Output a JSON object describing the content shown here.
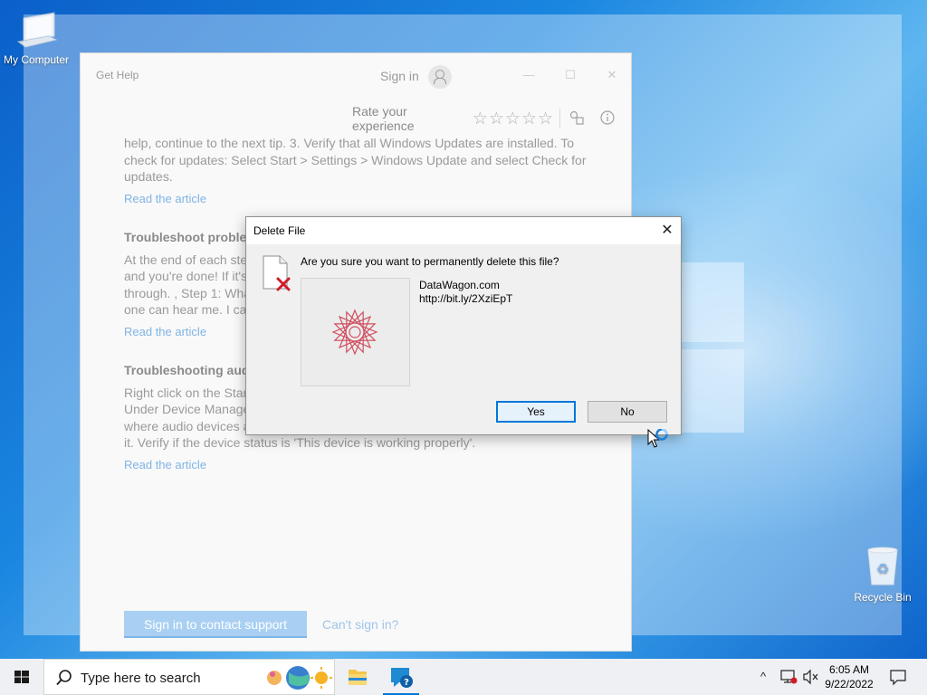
{
  "desktop": {
    "icons": {
      "my_computer": "My Computer",
      "recycle_bin": "Recycle Bin"
    }
  },
  "help_window": {
    "title": "Get Help",
    "sign_in": "Sign in",
    "controls": {
      "minimize": "—",
      "maximize": "☐",
      "close": "✕"
    },
    "rate_label": "Rate your experience",
    "stars": 5,
    "article1_text_1": "help, continue to the next tip. 3. Verify that all Windows Updates are installed. To",
    "article1_text_2": "check for updates: Select Start > Settings > Windows Update and select Check for",
    "article1_text_3": "updates.",
    "article1_link": "Read the article",
    "article2_heading": "Troubleshoot problen",
    "article2_text_1": "At the end of each ste",
    "article2_text_2": "and you're done! If it's",
    "article2_text_3": "through. , Step 1: Wha",
    "article2_text_4": "one can hear me. I can",
    "article2_link": "Read the article",
    "article3_heading": "Troubleshooting audi",
    "article3_text_1": "Right click on the Star",
    "article3_text_2": "Under Device Manage",
    "article3_text_3": "where audio devices are listed. Locate your audio device/driver and double click on",
    "article3_text_4": "it. Verify if the device status is 'This device is working properly'.",
    "article3_link": "Read the article",
    "contact_button": "Sign in to contact support",
    "cant_sign_in": "Can't sign in?"
  },
  "dialog": {
    "title": "Delete File",
    "close": "✕",
    "question": "Are you sure you want to permanently delete this file?",
    "file_name": "DataWagon.com",
    "file_url": "http://bit.ly/2XziEpT",
    "yes_label": "Yes",
    "no_label": "No"
  },
  "taskbar": {
    "search_placeholder": "Type here to search",
    "time": "6:05 AM",
    "date": "9/22/2022",
    "tray_chevron": "^",
    "accent": "#0078d7"
  },
  "icons": [
    "windows-start-icon",
    "search-icon",
    "file-explorer-icon",
    "get-help-icon",
    "monitor-icon",
    "network-icon",
    "volume-muted-icon",
    "notification-icon"
  ]
}
